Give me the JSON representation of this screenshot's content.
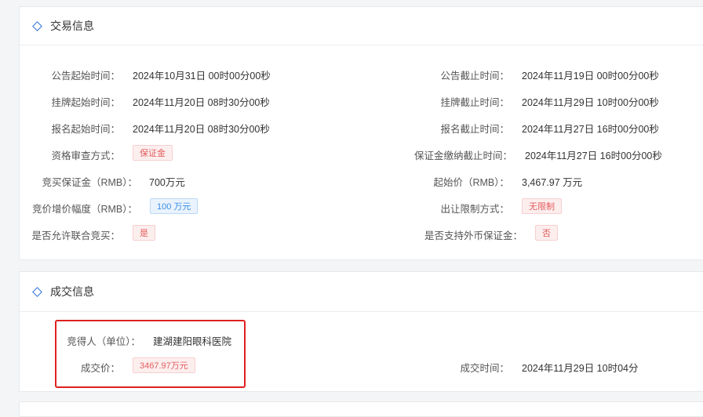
{
  "trade_section": {
    "title": "交易信息",
    "left": [
      {
        "label": "公告起始时间：",
        "value": "2024年10月31日 00时00分00秒"
      },
      {
        "label": "挂牌起始时间：",
        "value": "2024年11月20日 08时30分00秒"
      },
      {
        "label": "报名起始时间：",
        "value": "2024年11月20日 08时30分00秒"
      },
      {
        "label": "资格审查方式：",
        "tag": "保证金"
      },
      {
        "label": "竞买保证金（RMB）：",
        "value": "700万元"
      },
      {
        "label": "竞价增价幅度（RMB）：",
        "tag": "100 万元"
      },
      {
        "label": "是否允许联合竞买：",
        "tag": "是"
      }
    ],
    "right": [
      {
        "label": "公告截止时间：",
        "value": "2024年11月19日 00时00分00秒"
      },
      {
        "label": "挂牌截止时间：",
        "value": "2024年11月29日 10时00分00秒"
      },
      {
        "label": "报名截止时间：",
        "value": "2024年11月27日 16时00分00秒"
      },
      {
        "label": "保证金缴纳截止时间：",
        "value": "2024年11月27日 16时00分00秒"
      },
      {
        "label": "起始价（RMB）：",
        "value": "3,467.97 万元"
      },
      {
        "label": "出让限制方式：",
        "tag": "无限制"
      },
      {
        "label": "是否支持外币保证金：",
        "tag": "否"
      }
    ]
  },
  "deal_section": {
    "title": "成交信息",
    "winner_label": "竞得人（单位）：",
    "winner_value": "建湖建阳眼科医院",
    "price_label": "成交价：",
    "price_tag": "3467.97万元",
    "time_label": "成交时间：",
    "time_value": "2024年11月29日 10时04分"
  },
  "colors": {
    "accent": "#2b6fd6",
    "tag_red": "#e25d5d",
    "tag_blue": "#3a8ee6",
    "highlight": "#e02020"
  }
}
